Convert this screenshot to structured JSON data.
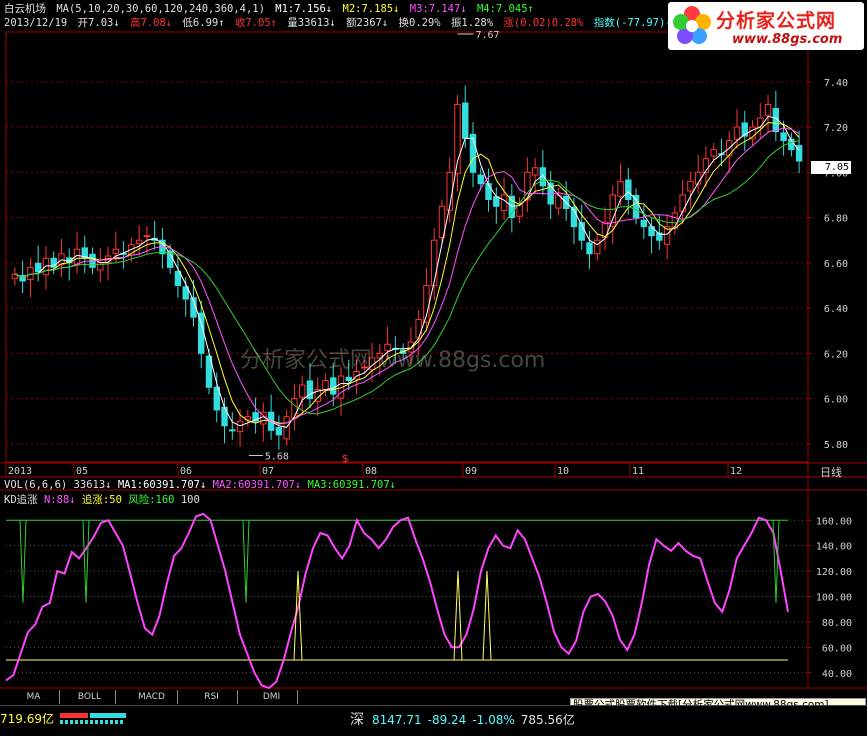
{
  "header": {
    "stock_name": "白云机场",
    "ma_params": "MA(5,10,20,30,60,120,240,360,4,1)",
    "m1": "M1:7.156↓",
    "m2": "M2:7.185↓",
    "m3": "M3:7.147↓",
    "m4": "M4:7.045↑",
    "date": "2013/12/19",
    "open": "开7.03↓",
    "high": "高7.08↓",
    "low": "低6.99↑",
    "close": "收7.05↑",
    "volume": "量33613↓",
    "amount": "额2367↓",
    "turnover": "换0.29%",
    "amplitude": "振1.28%",
    "change": "涨(0.02)0.28%",
    "index": "指数(-77.97)-3.54%"
  },
  "logo": {
    "name": "分析家公式网",
    "url": "www.88gs.com"
  },
  "watermark": "分析家公式网 www.88gs.com",
  "colors": {
    "bg": "#000000",
    "up": "#ff3333",
    "down": "#33dddd",
    "ma1": "#ffffff",
    "ma2": "#ffff33",
    "ma3": "#ff55ff",
    "ma4": "#33cc33",
    "grid": "#8b0000"
  },
  "price_axis": {
    "ticks": [
      "7.40",
      "7.20",
      "7.00",
      "6.80",
      "6.60",
      "6.40",
      "6.20",
      "6.00",
      "5.80"
    ],
    "range": [
      5.72,
      7.62
    ],
    "current": "7.05"
  },
  "annotations": {
    "high_label": "7.67",
    "low_label": "5.68",
    "marker": "$"
  },
  "time_axis": {
    "labels": [
      "2013",
      "05",
      "06",
      "07",
      "08",
      "09",
      "10",
      "11",
      "12"
    ],
    "period": "日线"
  },
  "vol_panel": {
    "title": "VOL(6,6,6)",
    "value": "33613↓",
    "ma1": "MA1:60391.707↓",
    "ma2": "MA2:60391.707↓",
    "ma3": "MA3:60391.707↓"
  },
  "kd_panel": {
    "title": "KD追涨",
    "n": "N:88↓",
    "chase": "追涨:50",
    "risk": "风险:160",
    "level": "100",
    "ticks": [
      "160.00",
      "140.00",
      "120.00",
      "100.00",
      "80.00",
      "60.00",
      "40.00"
    ],
    "range": [
      28,
      172
    ]
  },
  "chart_data": {
    "type": "line",
    "series": [
      {
        "name": "N",
        "values": [
          34,
          38,
          55,
          72,
          78,
          92,
          95,
          120,
          118,
          135,
          130,
          138,
          147,
          158,
          160,
          150,
          140,
          118,
          95,
          75,
          70,
          85,
          110,
          132,
          138,
          150,
          163,
          165,
          160,
          140,
          120,
          95,
          70,
          55,
          40,
          30,
          28,
          33,
          50,
          72,
          92,
          118,
          138,
          150,
          148,
          138,
          130,
          140,
          160,
          150,
          145,
          138,
          145,
          155,
          160,
          162,
          145,
          130,
          112,
          90,
          70,
          60,
          60,
          70,
          90,
          120,
          138,
          148,
          140,
          138,
          152,
          145,
          130,
          115,
          95,
          72,
          60,
          55,
          65,
          88,
          100,
          102,
          96,
          85,
          66,
          58,
          70,
          95,
          125,
          145,
          140,
          136,
          142,
          136,
          132,
          130,
          112,
          95,
          88,
          105,
          130,
          140,
          150,
          162,
          160,
          150,
          120,
          88
        ]
      },
      {
        "name": "追涨",
        "values": [
          50,
          50,
          50,
          50,
          50,
          50,
          50,
          50,
          50,
          50,
          50,
          50,
          50,
          50,
          50,
          50,
          50,
          50,
          50,
          50,
          50,
          50,
          50,
          50,
          50,
          50,
          50,
          50,
          50,
          50,
          50,
          50,
          50,
          50,
          50,
          50,
          50,
          50,
          50,
          50,
          50,
          50,
          50,
          50,
          50,
          50,
          50,
          50,
          50,
          50,
          50,
          50,
          50,
          50,
          50,
          50,
          50,
          50,
          50,
          50,
          50,
          50,
          50,
          50,
          50,
          50,
          50,
          50,
          50,
          50,
          50,
          50,
          50,
          50,
          50,
          50,
          50,
          50,
          50,
          50,
          50,
          50,
          50,
          50,
          50,
          50,
          50,
          50,
          50,
          50,
          50,
          50,
          50,
          50,
          50,
          50,
          50,
          50,
          50,
          50,
          50,
          50,
          50,
          50,
          50,
          50,
          50,
          50
        ]
      },
      {
        "name": "风险",
        "values": [
          160,
          160,
          160,
          160,
          160,
          160,
          160,
          160,
          160,
          160,
          160,
          160,
          160,
          160,
          160,
          160,
          160,
          160,
          160,
          160,
          160,
          160,
          160,
          160,
          160,
          160,
          160,
          160,
          160,
          160,
          160,
          160,
          160,
          160,
          160,
          160,
          160,
          160,
          160,
          160,
          160,
          160,
          160,
          160,
          160,
          160,
          160,
          160,
          160,
          160,
          160,
          160,
          160,
          160,
          160,
          160,
          160,
          160,
          160,
          160,
          160,
          160,
          160,
          160,
          160,
          160,
          160,
          160,
          160,
          160,
          160,
          160,
          160,
          160,
          160,
          160,
          160,
          160,
          160,
          160,
          160,
          160,
          160,
          160,
          160,
          160,
          160,
          160,
          160,
          160,
          160,
          160,
          160,
          160,
          160,
          160,
          160,
          160,
          160,
          160,
          160,
          160,
          160,
          160,
          160,
          160,
          160,
          160
        ]
      }
    ],
    "price": {
      "close": [
        6.55,
        6.52,
        6.58,
        6.56,
        6.62,
        6.58,
        6.64,
        6.6,
        6.66,
        6.62,
        6.58,
        6.6,
        6.63,
        6.66,
        6.64,
        6.68,
        6.7,
        6.72,
        6.7,
        6.64,
        6.58,
        6.5,
        6.44,
        6.36,
        6.2,
        6.05,
        5.95,
        5.88,
        5.86,
        5.9,
        5.92,
        5.9,
        5.94,
        5.86,
        5.84,
        5.92,
        6.0,
        6.06,
        6.0,
        6.04,
        6.08,
        6.02,
        6.1,
        6.08,
        6.12,
        6.14,
        6.18,
        6.2,
        6.24,
        6.22,
        6.2,
        6.25,
        6.35,
        6.5,
        6.7,
        6.85,
        7.0,
        7.3,
        7.15,
        7.0,
        6.95,
        6.88,
        6.85,
        6.9,
        6.8,
        6.86,
        7.0,
        7.02,
        6.94,
        6.86,
        6.9,
        6.84,
        6.76,
        6.7,
        6.64,
        6.7,
        6.78,
        6.9,
        6.96,
        6.88,
        6.8,
        6.76,
        6.72,
        6.7,
        6.76,
        6.82,
        6.9,
        6.96,
        7.0,
        7.06,
        7.1,
        7.08,
        7.14,
        7.2,
        7.16,
        7.2,
        7.24,
        7.3,
        7.18,
        7.14,
        7.1,
        7.05
      ]
    }
  }
}
